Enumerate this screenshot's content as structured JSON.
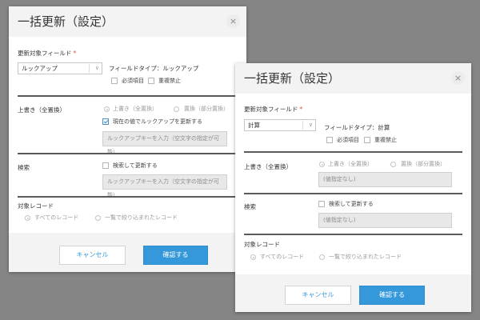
{
  "dialog_a": {
    "title": "一括更新（設定）",
    "close": "×",
    "target_field": {
      "label": "更新対象フィールド",
      "required": "*",
      "value": "ルックアップ"
    },
    "field_type": "フィールドタイプ：ルックアップ",
    "required_item": "必須項目",
    "no_duplicates": "重複禁止",
    "overwrite": {
      "label": "上書き（全置換）",
      "option_overwrite": "上書き（全置換）",
      "option_replace": "置換（部分置換）",
      "update_lookup": "現在の値でルックアップを更新する",
      "lookup_key_placeholder": "ルックアップキーを入力（空文字の指定が可能）"
    },
    "search": {
      "label": "検索",
      "update_after_search": "検索して更新する",
      "lookup_key_placeholder": "ルックアップキーを入力（空文字の指定が可能）"
    },
    "target_records": {
      "label": "対象レコード",
      "all": "すべてのレコード",
      "filtered": "一覧で絞り込まれたレコード"
    },
    "cancel": "キャンセル",
    "confirm": "確認する"
  },
  "dialog_b": {
    "title": "一括更新（設定）",
    "close": "×",
    "target_field": {
      "label": "更新対象フィールド",
      "required": "*",
      "value": "計算"
    },
    "field_type": "フィールドタイプ：計算",
    "required_item": "必須項目",
    "no_duplicates": "重複禁止",
    "overwrite": {
      "label": "上書き（全置換）",
      "option_overwrite": "上書き（全置換）",
      "option_replace": "置換（部分置換）",
      "value_placeholder": "(値指定なし)"
    },
    "search": {
      "label": "検索",
      "update_after_search": "検索して更新する",
      "value_placeholder": "(値指定なし)"
    },
    "target_records": {
      "label": "対象レコード",
      "all": "すべてのレコード",
      "filtered": "一覧で絞り込まれたレコード"
    },
    "cancel": "キャンセル",
    "confirm": "確認する"
  },
  "icons": {
    "chevron": "chevron-down-icon",
    "check": "check-icon",
    "close": "close-icon"
  },
  "colors": {
    "primary": "#3498db",
    "required": "#e04a3f",
    "backdrop": "#858585"
  }
}
